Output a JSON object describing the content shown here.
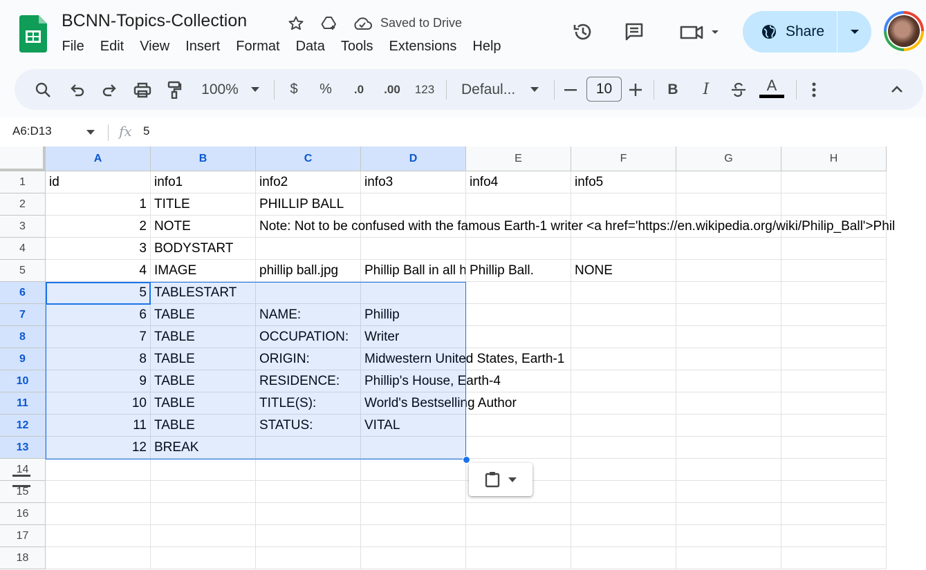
{
  "app": {
    "doc_title": "BCNN-Topics-Collection",
    "saved_status": "Saved to Drive",
    "menu": [
      "File",
      "Edit",
      "View",
      "Insert",
      "Format",
      "Data",
      "Tools",
      "Extensions",
      "Help"
    ],
    "share_label": "Share"
  },
  "toolbar": {
    "zoom": "100%",
    "currency": "$",
    "percent": "%",
    "dec_decrease": ".0",
    "dec_increase": ".00",
    "number_format": "123",
    "font": "Defaul...",
    "font_size": "10",
    "bold": "B",
    "italic": "I",
    "text_color": "A"
  },
  "formula_bar": {
    "name_box": "A6:D13",
    "fx_label": "fx",
    "value": "5"
  },
  "grid": {
    "columns": [
      "A",
      "B",
      "C",
      "D",
      "E",
      "F",
      "G",
      "H"
    ],
    "selected_columns": [
      "A",
      "B",
      "C",
      "D"
    ],
    "row_numbers": [
      "1",
      "2",
      "3",
      "4",
      "5",
      "6",
      "7",
      "8",
      "9",
      "10",
      "11",
      "12",
      "13",
      "14",
      "15",
      "16",
      "17",
      "18"
    ],
    "selected_rows": [
      "6",
      "7",
      "8",
      "9",
      "10",
      "11",
      "12",
      "13"
    ],
    "rows": [
      [
        "id",
        "info1",
        "info2",
        "info3",
        "info4",
        "info5",
        "",
        ""
      ],
      [
        "1",
        "TITLE",
        "PHILLIP BALL",
        "",
        "",
        "",
        "",
        ""
      ],
      [
        "2",
        "NOTE",
        "Note: Not to be confused with the famous Earth-1 writer <a href='https://en.wikipedia.org/wiki/Philip_Ball'>Phil",
        "",
        "",
        "",
        "",
        ""
      ],
      [
        "3",
        "BODYSTART",
        "",
        "",
        "",
        "",
        "",
        ""
      ],
      [
        "4",
        "IMAGE",
        "phillip ball.jpg",
        "Phillip Ball in all his glory",
        "Phillip Ball.",
        "NONE",
        "",
        ""
      ],
      [
        "5",
        "TABLESTART",
        "",
        "",
        "",
        "",
        "",
        ""
      ],
      [
        "6",
        "TABLE",
        "NAME:",
        "Phillip",
        "",
        "",
        "",
        ""
      ],
      [
        "7",
        "TABLE",
        "OCCUPATION:",
        "Writer",
        "",
        "",
        "",
        ""
      ],
      [
        "8",
        "TABLE",
        "ORIGIN:",
        "Midwestern United States, Earth-1",
        "",
        "",
        "",
        ""
      ],
      [
        "9",
        "TABLE",
        "RESIDENCE:",
        "Phillip's House, Earth-4",
        "",
        "",
        "",
        ""
      ],
      [
        "10",
        "TABLE",
        "TITLE(S):",
        "World's Bestselling Author",
        "",
        "",
        "",
        ""
      ],
      [
        "11",
        "TABLE",
        "STATUS:",
        "VITAL",
        "",
        "",
        "",
        ""
      ],
      [
        "12",
        "BREAK",
        "",
        "",
        "",
        "",
        "",
        ""
      ],
      [
        "",
        "",
        "",
        "",
        "",
        "",
        "",
        ""
      ],
      [
        "",
        "",
        "",
        "",
        "",
        "",
        "",
        ""
      ],
      [
        "",
        "",
        "",
        "",
        "",
        "",
        "",
        ""
      ],
      [
        "",
        "",
        "",
        "",
        "",
        "",
        "",
        ""
      ],
      [
        "",
        "",
        "",
        "",
        "",
        "",
        "",
        ""
      ]
    ]
  },
  "colors": {
    "accent": "#1a73e8",
    "share_bg": "#c2e7ff",
    "selection_header": "#d3e3fd",
    "sheets_green": "#0f9d58"
  }
}
